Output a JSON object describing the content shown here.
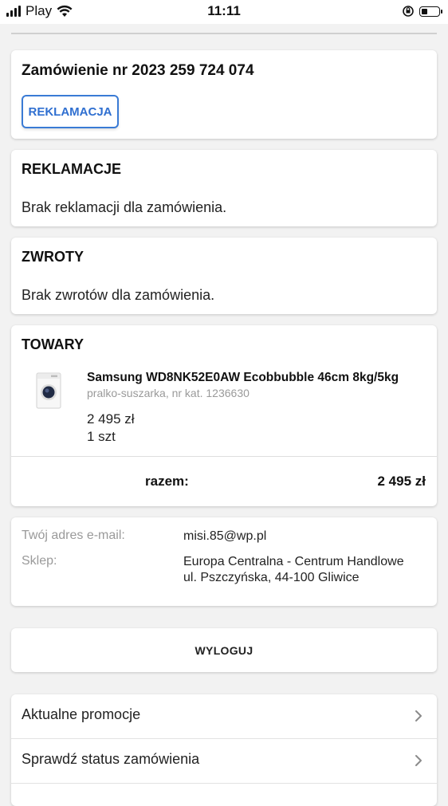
{
  "status_bar": {
    "carrier": "Play",
    "time": "11:11"
  },
  "order": {
    "title": "Zamówienie nr 2023 259 724 074",
    "complaint_button": "REKLAMACJA"
  },
  "complaints": {
    "title": "REKLAMACJE",
    "empty_text": "Brak reklamacji dla zamówienia."
  },
  "returns": {
    "title": "ZWROTY",
    "empty_text": "Brak zwrotów dla zamówienia."
  },
  "products": {
    "title": "TOWARY",
    "items": [
      {
        "name": "Samsung WD8NK52E0AW Ecobbubble 46cm 8kg/5kg",
        "subtitle": "pralko-suszarka, nr kat. 1236630",
        "price": "2 495 zł",
        "quantity": "1 szt",
        "image_icon": "washer-dryer-image"
      }
    ],
    "total_label": "razem:",
    "total_value": "2 495 zł"
  },
  "info": {
    "email_label": "Twój adres e-mail:",
    "email_value": "misi.85@wp.pl",
    "store_label": "Sklep:",
    "store_line1": "Europa Centralna - Centrum Handlowe",
    "store_line2": "ul. Pszczyńska, 44-100 Gliwice"
  },
  "logout": {
    "label": "WYLOGUJ"
  },
  "menu": {
    "items": [
      {
        "label": "Aktualne promocje",
        "icon": "chevron-right-icon"
      },
      {
        "label": "Sprawdź status zamówienia",
        "icon": "chevron-right-icon"
      }
    ]
  },
  "colors": {
    "accent": "#2f6fd0",
    "background": "#f2f2f2",
    "muted_text": "#9a9a9a"
  }
}
